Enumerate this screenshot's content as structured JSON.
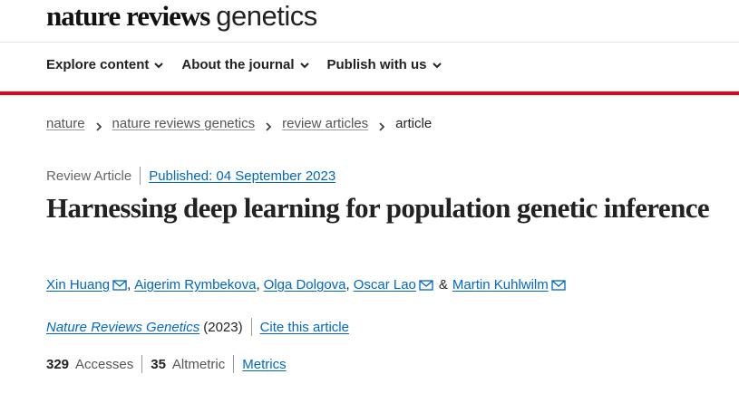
{
  "brand": {
    "strong": "nature reviews",
    "light": "genetics"
  },
  "nav": [
    {
      "label": "Explore content"
    },
    {
      "label": "About the journal"
    },
    {
      "label": "Publish with us"
    }
  ],
  "breadcrumb": [
    {
      "label": "nature"
    },
    {
      "label": "nature reviews genetics"
    },
    {
      "label": "review articles"
    },
    {
      "label": "article"
    }
  ],
  "article": {
    "type": "Review Article",
    "published": "Published: 04 September 2023",
    "title": "Harnessing deep learning for population genetic inference",
    "authors": [
      {
        "name": "Xin Huang",
        "mail": true
      },
      {
        "name": "Aigerim Rymbekova",
        "mail": false
      },
      {
        "name": "Olga Dolgova",
        "mail": false
      },
      {
        "name": "Oscar Lao",
        "mail": true
      },
      {
        "name": "Martin Kuhlwilm",
        "mail": true
      }
    ],
    "author_separator": ",",
    "author_amp": "&",
    "journal": "Nature Reviews Genetics",
    "year": "(2023)",
    "cite": "Cite this article"
  },
  "metrics": {
    "accesses_count": "329",
    "accesses_label": "Accesses",
    "altmetric_count": "35",
    "altmetric_label": "Altmetric",
    "metrics_link": "Metrics"
  },
  "colors": {
    "accent_red": "#e3001b",
    "link_blue": "#0067c5"
  }
}
